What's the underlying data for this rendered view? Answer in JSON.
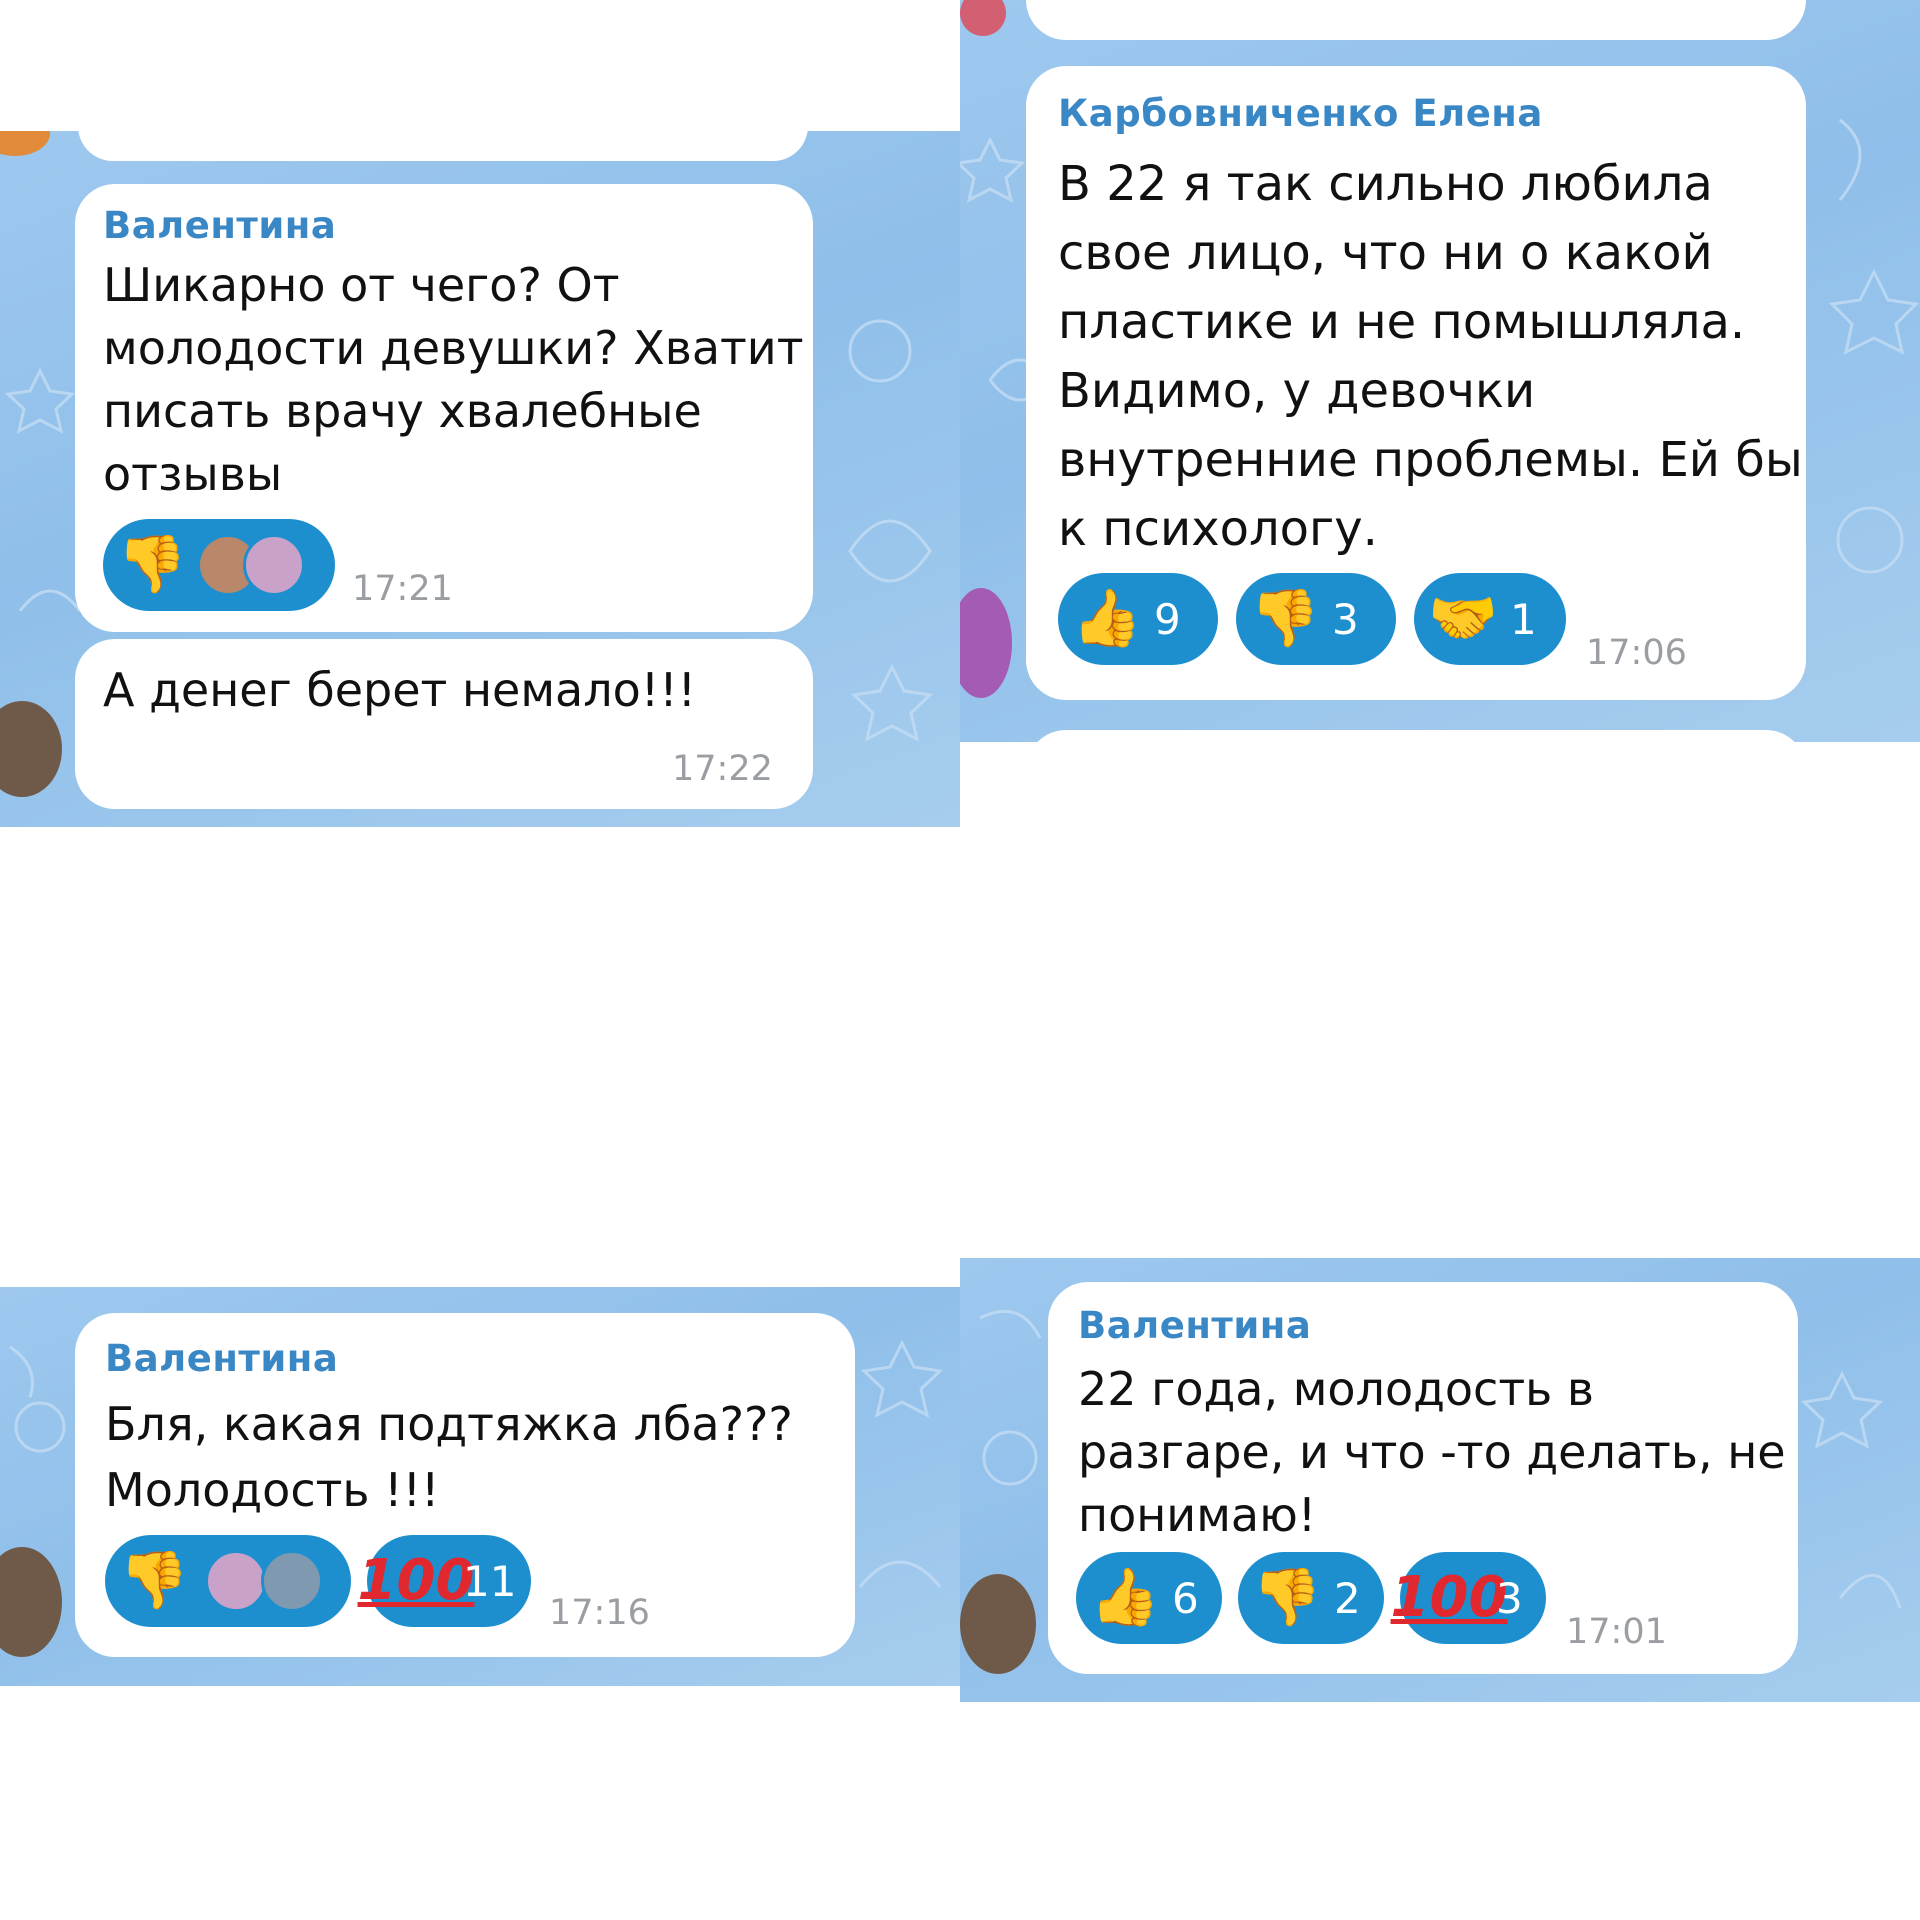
{
  "panels": [
    {
      "messages": [
        {
          "sender": "Валентина",
          "text": "Шикарно от чего? От\nмолодости девушки? Хватит\nписать врачу хвалебные\nотзывы",
          "time": "17:21",
          "reactions": [
            {
              "emoji": "thumbs-down",
              "voters": [
                "avatar",
                "avatar"
              ]
            }
          ]
        },
        {
          "sender": "",
          "text": "А денег берет немало!!!",
          "time": "17:22",
          "reactions": []
        }
      ]
    },
    {
      "messages": [
        {
          "sender": "Карбовниченко Елена",
          "text": "В 22 я так сильно любила\nсвое лицо, что ни о какой\nпластике и не помышляла.\nВидимо, у девочки\nвнутренние проблемы. Ей бы\nк психологу.",
          "time": "17:06",
          "reactions": [
            {
              "emoji": "thumbs-up",
              "count": "9"
            },
            {
              "emoji": "thumbs-down",
              "count": "3"
            },
            {
              "emoji": "handshake",
              "count": "1"
            }
          ]
        }
      ]
    },
    {
      "messages": [
        {
          "sender": "Валентина",
          "text": "Бля, какая подтяжка лба???\nМолодость !!!",
          "time": "17:16",
          "reactions": [
            {
              "emoji": "thumbs-down",
              "voters": [
                "avatar",
                "avatar"
              ]
            },
            {
              "emoji": "hundred-points",
              "glyph": "100",
              "count": "11"
            }
          ]
        }
      ]
    },
    {
      "messages": [
        {
          "sender": "Валентина",
          "text": "22 года, молодость в\nразгаре, и что -то делать, не\nпонимаю!",
          "time": "17:01",
          "reactions": [
            {
              "emoji": "thumbs-up",
              "count": "6"
            },
            {
              "emoji": "thumbs-down",
              "count": "2"
            },
            {
              "emoji": "hundred-points",
              "glyph": "100",
              "count": "3"
            }
          ]
        }
      ]
    }
  ],
  "colors": {
    "chat_background": "#92c2ec",
    "bubble": "#ffffff",
    "sender_name": "#3a87c6",
    "reaction_pill": "#1d8fcf",
    "timestamp": "#9a9ea3",
    "hundred_glyph": "#e0282e"
  }
}
